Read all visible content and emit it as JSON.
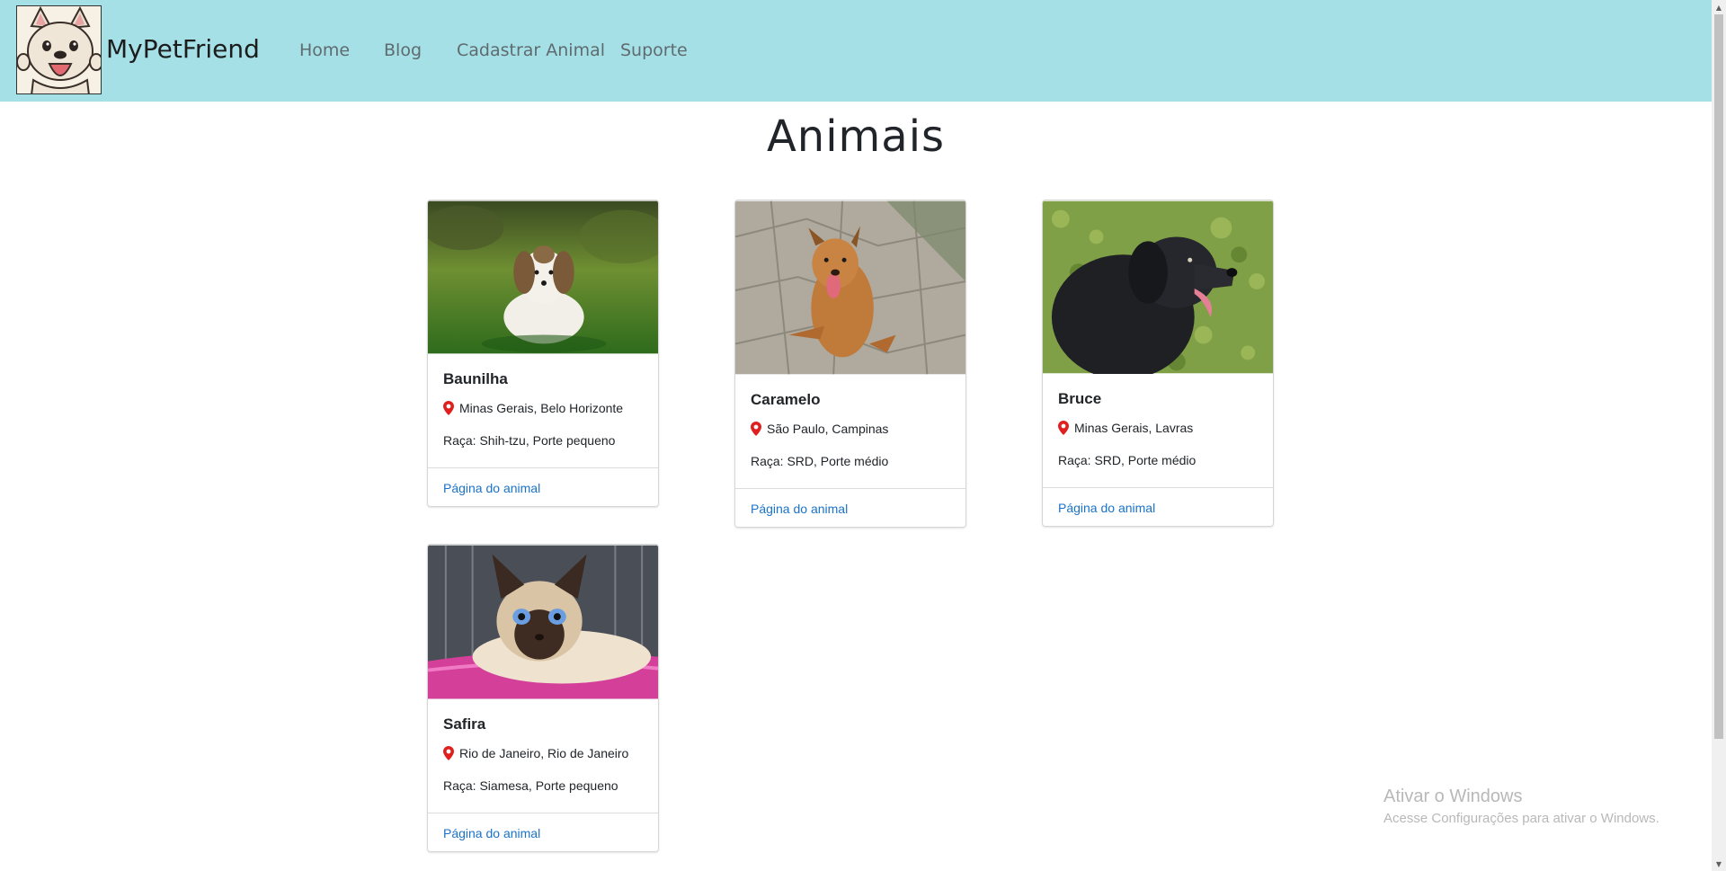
{
  "navbar": {
    "brand": "MyPetFriend",
    "links": [
      "Home",
      "Blog",
      "Cadastrar Animal",
      "Suporte"
    ]
  },
  "page": {
    "title": "Animais"
  },
  "cards": [
    {
      "name": "Baunilha",
      "location": "Minas Gerais, Belo Horizonte",
      "breed": "Raça: Shih-tzu, Porte pequeno",
      "link": "Página do animal"
    },
    {
      "name": "Caramelo",
      "location": "São Paulo, Campinas",
      "breed": "Raça: SRD, Porte médio",
      "link": "Página do animal"
    },
    {
      "name": "Bruce",
      "location": "Minas Gerais, Lavras",
      "breed": "Raça: SRD, Porte médio",
      "link": "Página do animal"
    },
    {
      "name": "Safira",
      "location": "Rio de Janeiro, Rio de Janeiro",
      "breed": "Raça: Siamesa, Porte pequeno",
      "link": "Página do animal"
    }
  ],
  "watermark": {
    "title": "Ativar o Windows",
    "subtitle": "Acesse Configurações para ativar o Windows."
  },
  "colors": {
    "navbar_bg": "#a5e0e7",
    "link": "#1a73c9",
    "pin": "#e0201f"
  },
  "icons": [
    "location-pin-icon",
    "scroll-up-arrow-icon",
    "scroll-down-arrow-icon"
  ]
}
